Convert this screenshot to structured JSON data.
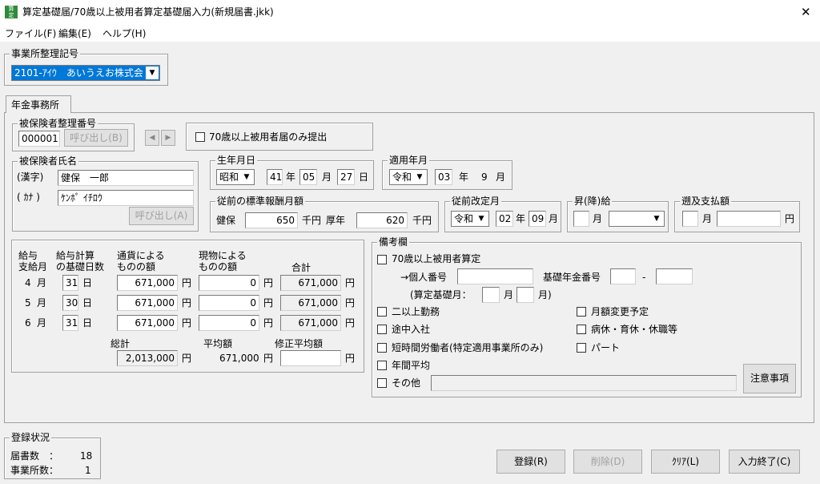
{
  "window": {
    "title": "算定基礎届/70歳以上被用者算定基礎届入力(新規届書.jkk)",
    "close": "✕"
  },
  "menu": {
    "file": "ファイル(F)",
    "edit": "編集(E)",
    "help": "ヘルプ(H)"
  },
  "office": {
    "legend": "事業所整理記号",
    "value": "2101-ｱｲｳ　あいうえお株式会"
  },
  "tab": {
    "label": "年金事務所"
  },
  "insured_no": {
    "legend": "被保険者整理番号",
    "value": "000001",
    "call": "呼び出し(B)",
    "prev": "◀",
    "next": "▶"
  },
  "only70": {
    "label": "70歳以上被用者届のみ提出"
  },
  "name": {
    "legend": "被保険者氏名",
    "kanji_label": "(漢字)",
    "kanji_value": "健保　一郎",
    "kana_label": "( ｶﾅ )",
    "kana_value": "ｹﾝﾎﾟ ｲﾁﾛｳ",
    "call": "呼び出し(A)"
  },
  "birth": {
    "legend": "生年月日",
    "era": "昭和",
    "year": "41",
    "y": "年",
    "month": "05",
    "m": "月",
    "day": "27",
    "d": "日"
  },
  "apply": {
    "legend": "適用年月",
    "era": "令和",
    "year": "03",
    "y": "年",
    "month": "9",
    "m": "月"
  },
  "prev_std": {
    "legend": "従前の標準報酬月額",
    "kenpo": "健保",
    "kenpo_value": "650",
    "unit1": "千円",
    "kosei": "厚年",
    "kosei_value": "620",
    "unit2": "千円"
  },
  "prev_rev": {
    "legend": "従前改定月",
    "era": "令和",
    "year": "02",
    "y": "年",
    "month": "09",
    "m": "月"
  },
  "raise": {
    "legend": "昇(降)給",
    "m": "月"
  },
  "retro": {
    "legend": "遡及支払額",
    "m": "月",
    "yen": "円"
  },
  "pay": {
    "h_month": [
      "給与",
      "支給月"
    ],
    "h_days": [
      "給与計算",
      "の基礎日数"
    ],
    "h_cash": [
      "通貨による",
      "ものの額"
    ],
    "h_kind": [
      "現物による",
      "ものの額"
    ],
    "h_total": "合計",
    "rows": [
      {
        "month": "4",
        "m": "月",
        "days": "31",
        "d": "日",
        "cash": "671,000",
        "kind": "0",
        "total": "671,000"
      },
      {
        "month": "5",
        "m": "月",
        "days": "30",
        "d": "日",
        "cash": "671,000",
        "kind": "0",
        "total": "671,000"
      },
      {
        "month": "6",
        "m": "月",
        "days": "31",
        "d": "日",
        "cash": "671,000",
        "kind": "0",
        "total": "671,000"
      }
    ],
    "yen": "円",
    "sum_label": "総計",
    "sum_value": "2,013,000",
    "avg_label": "平均額",
    "avg_value": "671,000",
    "mod_label": "修正平均額"
  },
  "remarks": {
    "legend": "備考欄",
    "over70": "70歳以上被用者算定",
    "indiv": "→個人番号",
    "basic": "基礎年金番号",
    "dash": "-",
    "base_month": "(算定基礎月：",
    "m1": "月",
    "m2": "月)",
    "multi": "二以上勤務",
    "mid": "途中入社",
    "short": "短時間労働者(特定適用事業所のみ)",
    "annual": "年間平均",
    "other": "その他",
    "change": "月額変更予定",
    "leave": "病休・育休・休職等",
    "part": "パート",
    "notice": "注意事項"
  },
  "status": {
    "legend": "登録状況",
    "forms_label": "届書数　：",
    "forms": "18",
    "offices_label": "事業所数：",
    "offices": "1"
  },
  "buttons": {
    "register": "登録(R)",
    "delete": "削除(D)",
    "clear": "ｸﾘｱ(L)",
    "finish": "入力終了(C)"
  }
}
